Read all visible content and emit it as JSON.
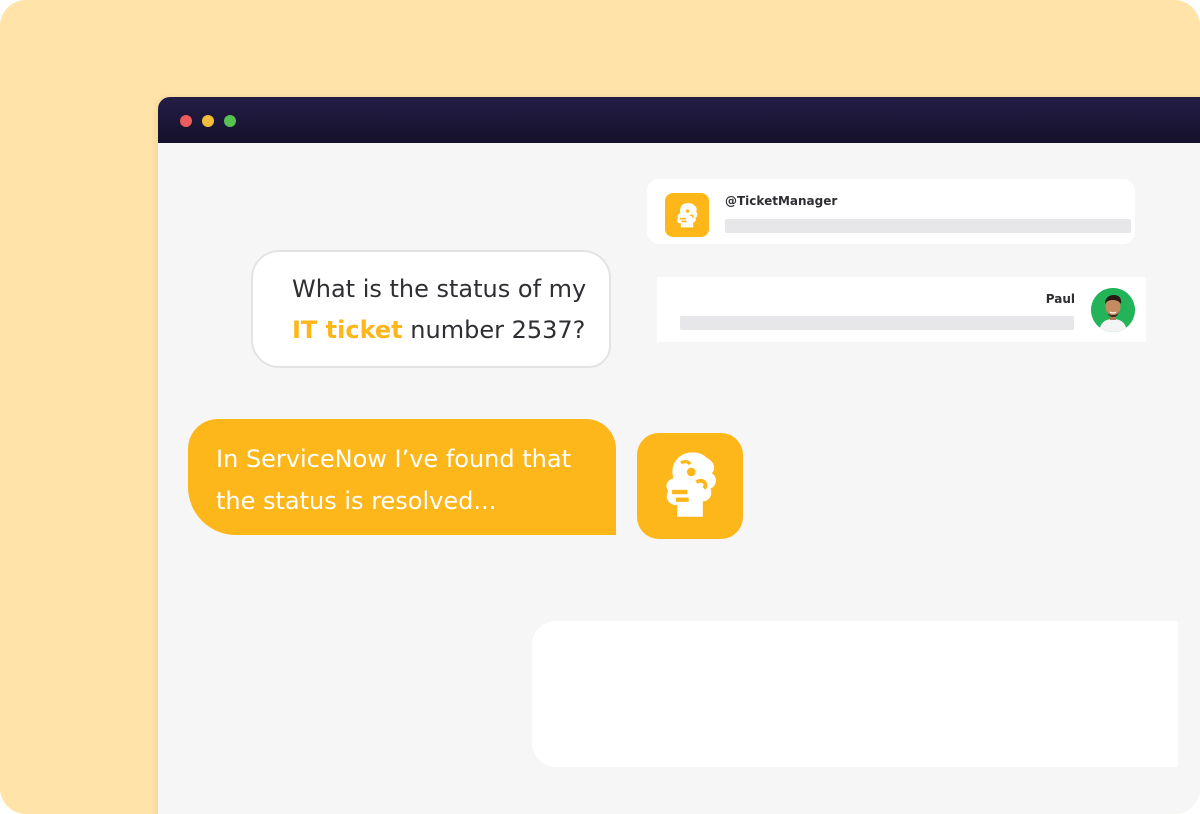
{
  "window": {
    "controls": [
      "close",
      "minimize",
      "maximize"
    ]
  },
  "mention_card": {
    "handle": "@TicketManager",
    "icon": "monkey-bot-icon"
  },
  "paul_card": {
    "name": "Paul",
    "avatar": "user-avatar"
  },
  "user_message": {
    "line1": "What is the status of my",
    "highlight": "IT ticket",
    "line2_rest": " number 2537?"
  },
  "bot_message": {
    "line1": "In ServiceNow I’ve found that",
    "line2": "the status is resolved..."
  },
  "colors": {
    "accent": "#FDB71A",
    "background": "#FFE3A8",
    "titlebar": "#1A1535",
    "window_bg": "#F6F6F6"
  }
}
